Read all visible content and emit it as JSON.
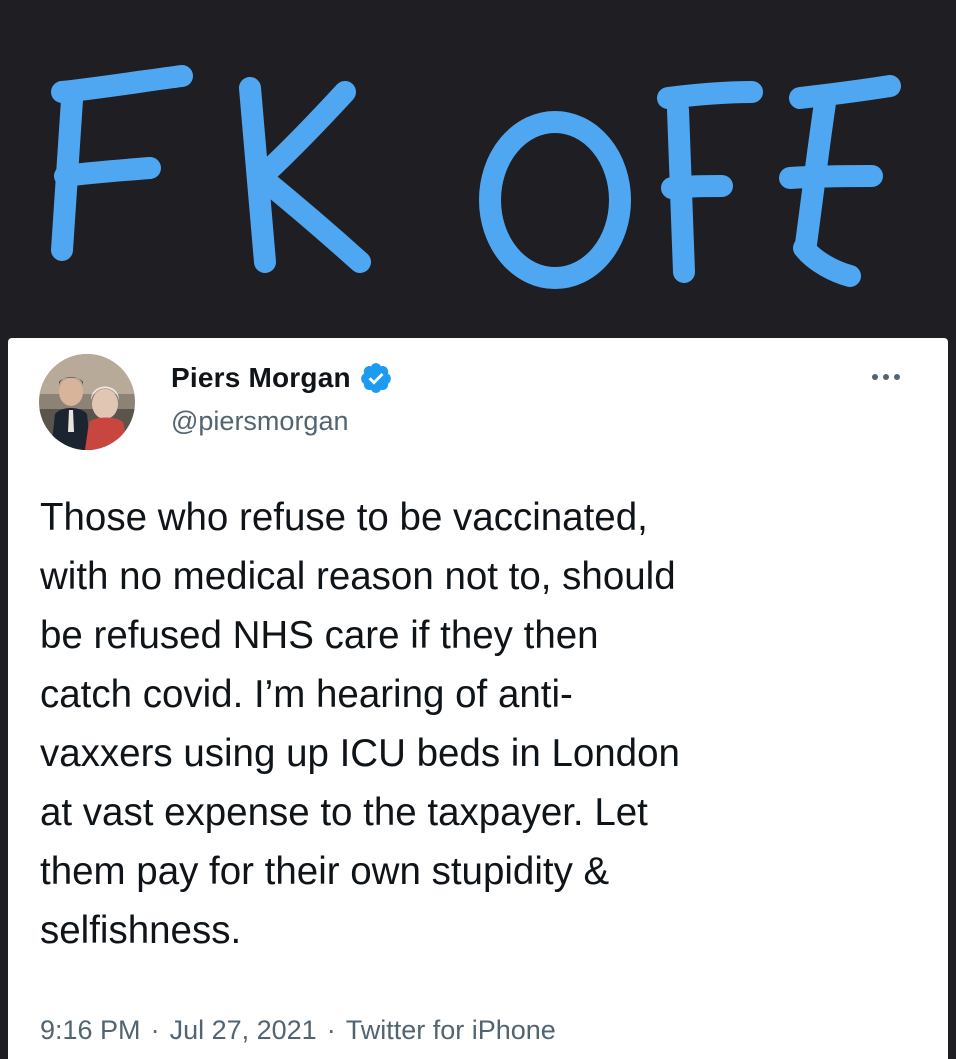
{
  "overlay": {
    "scrawl_text": "FK OFF",
    "scrawl_color": "#4fa7f2",
    "background_color": "#1f1e22"
  },
  "tweet": {
    "display_name": "Piers Morgan",
    "handle": "@piersmorgan",
    "verified": true,
    "verified_color": "#1d9bf0",
    "more_icon": "more-horizontal-icon",
    "text_lines": [
      "Those who refuse to be vaccinated,",
      "with no medical reason not to, should",
      "be refused NHS care if they then",
      "catch covid. I’m hearing of anti-",
      "vaxxers using up ICU beds in London",
      "at vast expense to the taxpayer. Let",
      "them pay for their own stupidity &",
      "selfishness."
    ],
    "time": "9:16 PM",
    "date": "Jul 27, 2021",
    "source": "Twitter for iPhone",
    "separator": "·"
  }
}
